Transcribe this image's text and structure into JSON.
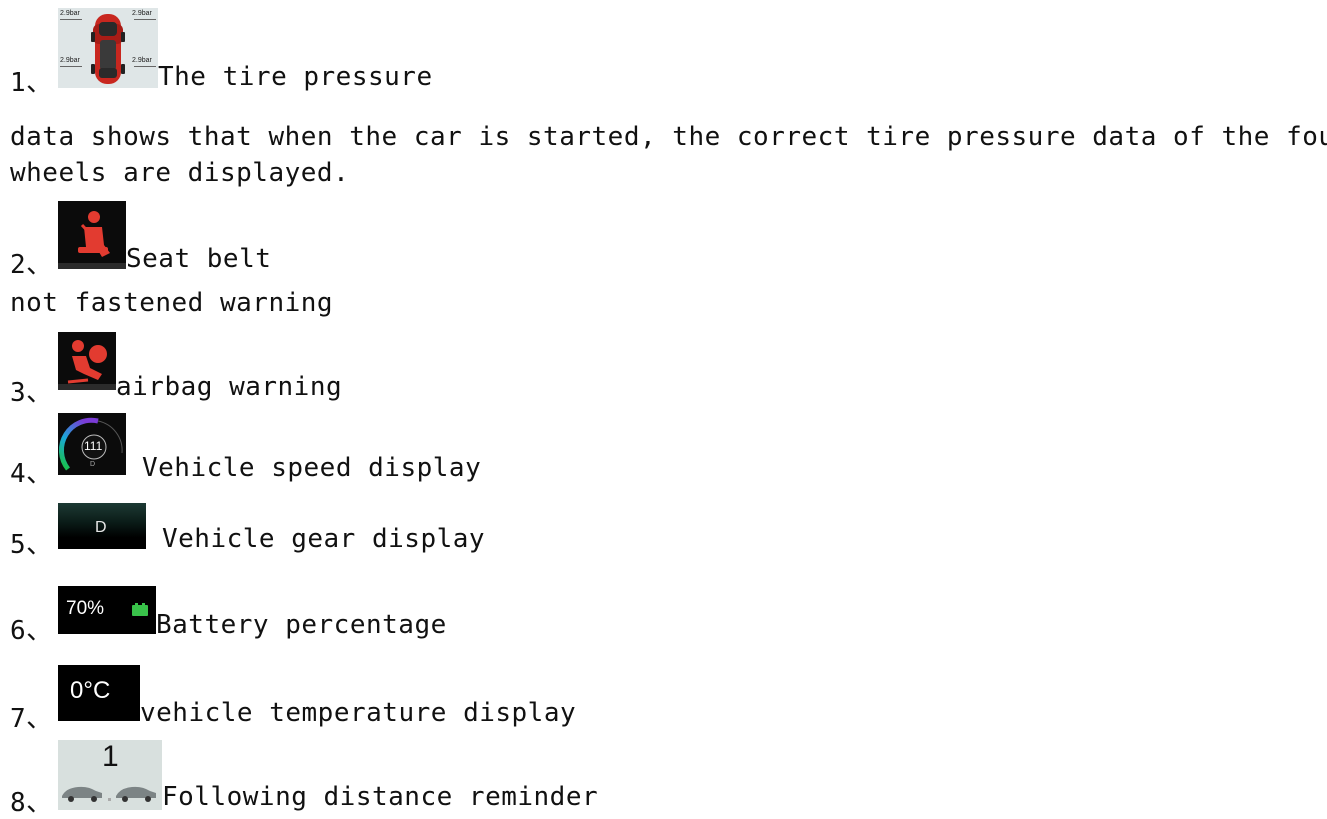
{
  "items": [
    {
      "num": "1、",
      "label": "The tire pressure",
      "continuation": "data shows that when the car is started, the correct tire pressure data of the four",
      "continuation2": "wheels are displayed.",
      "icon": "car-top-view-tire-pressure-icon",
      "tire_values": [
        "2.9bar",
        "2.9bar",
        "2.9bar",
        "2.9bar"
      ]
    },
    {
      "num": "2、",
      "label": "Seat belt",
      "continuation": "not fastened warning",
      "icon": "seatbelt-warning-icon",
      "color": "#e23b30"
    },
    {
      "num": "3、",
      "label": "airbag warning",
      "icon": "airbag-warning-icon",
      "color": "#e23b30"
    },
    {
      "num": "4、",
      "label": "Vehicle speed display",
      "icon": "speedometer-icon",
      "speed": "111",
      "gear": "D"
    },
    {
      "num": "5、",
      "label": "Vehicle gear display",
      "icon": "gear-display-icon",
      "gear": "D"
    },
    {
      "num": "6、",
      "label": "Battery percentage",
      "icon": "battery-icon",
      "battery": "70%",
      "battery_color": "#39c24a"
    },
    {
      "num": "7、",
      "label": "vehicle temperature display",
      "icon": "temperature-display-icon",
      "temperature": "0°C"
    },
    {
      "num": "8、",
      "label": "Following distance reminder",
      "icon": "following-distance-icon",
      "distance": "1"
    }
  ]
}
